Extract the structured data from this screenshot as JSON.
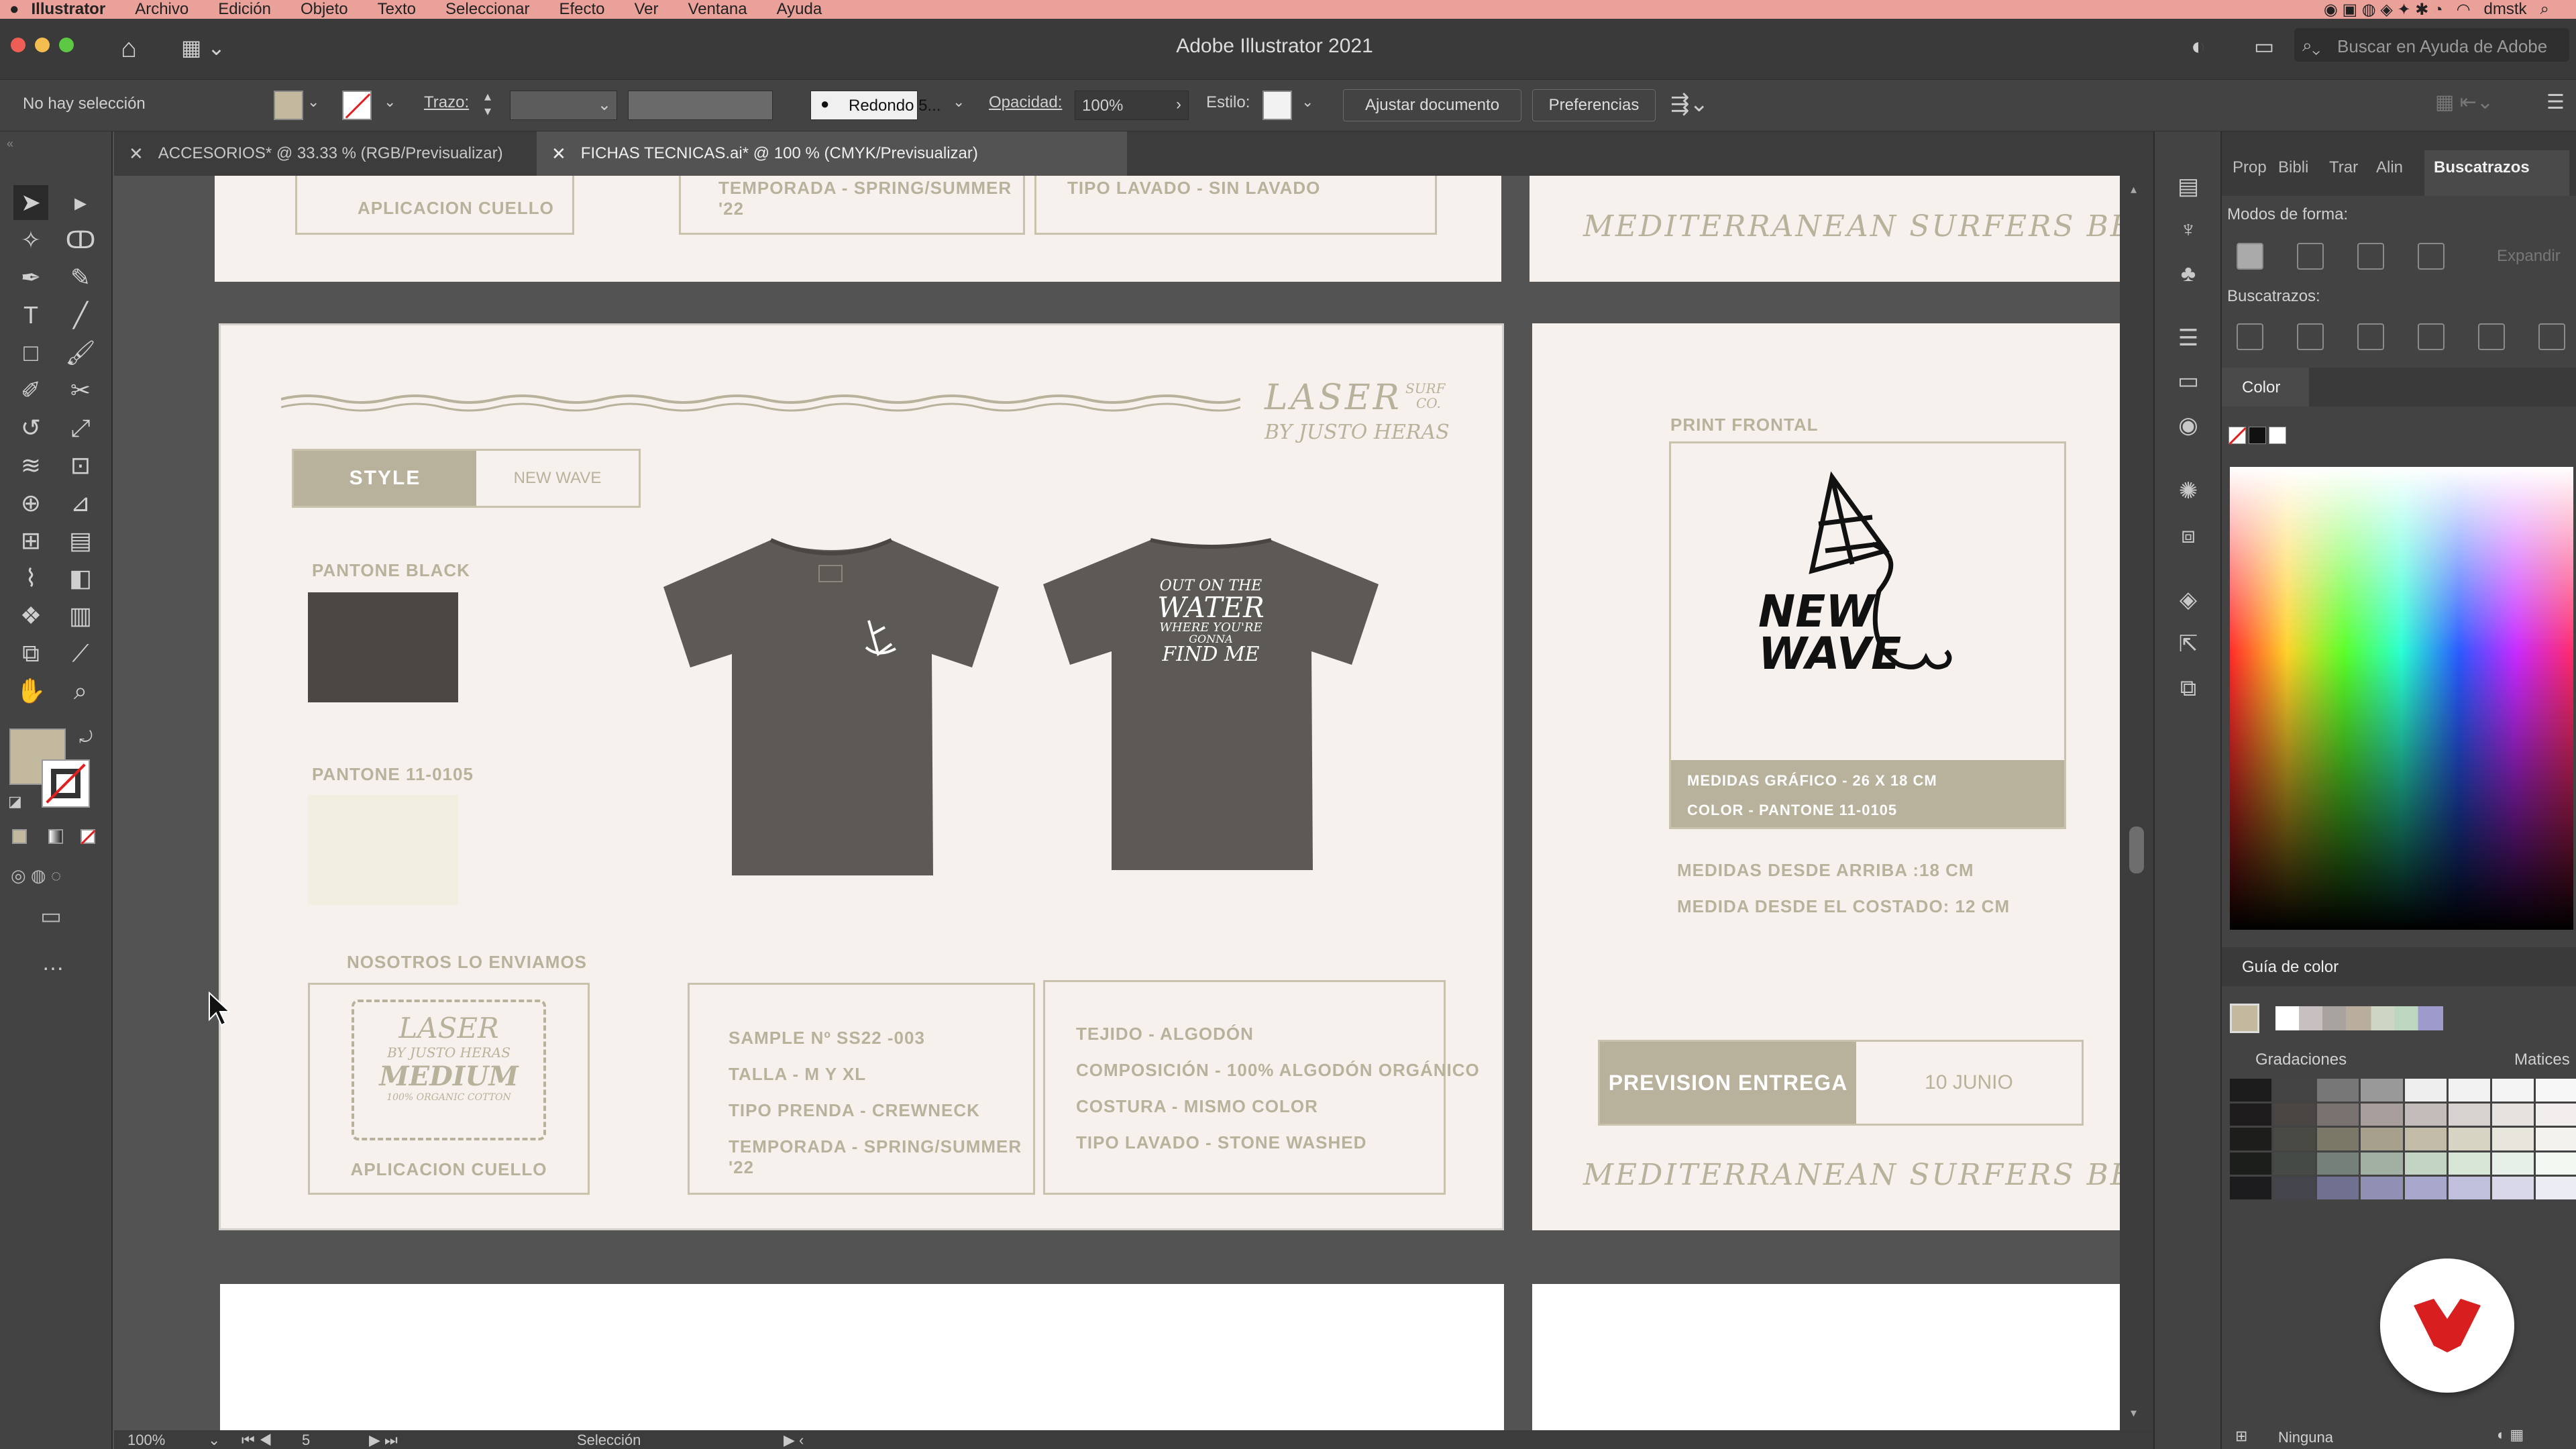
{
  "menubar": {
    "app_name": "Illustrator",
    "items": [
      "Archivo",
      "Edición",
      "Objeto",
      "Texto",
      "Seleccionar",
      "Efecto",
      "Ver",
      "Ventana",
      "Ayuda"
    ],
    "user": "dmstk"
  },
  "titlebar": {
    "title": "Adobe Illustrator 2021",
    "search_placeholder": "Buscar en Ayuda de Adobe"
  },
  "control_bar": {
    "selection": "No hay selección",
    "stroke_label": "Trazo:",
    "brush": "Redondo 5...",
    "opacity_label": "Opacidad:",
    "opacity_value": "100%",
    "style_label": "Estilo:",
    "fit_document": "Ajustar documento",
    "preferences": "Preferencias"
  },
  "tabs": [
    {
      "label": "ACCESORIOS* @ 33.33 % (RGB/Previsualizar)",
      "active": false
    },
    {
      "label": "FICHAS TECNICAS.ai* @ 100 % (CMYK/Previsualizar)",
      "active": true
    }
  ],
  "top_partial": {
    "collar": "APLICACION CUELLO",
    "season": "TEMPORADA - SPRING/SUMMER '22",
    "wash": "TIPO LAVADO -  SIN LAVADO",
    "slogan": "MEDITERRANEAN SURFERS  BE LIKE"
  },
  "board_left": {
    "brand_line1": "LASER",
    "brand_surf": "SURF",
    "brand_co": "CO.",
    "brand_line2": "BY JUSTO HERAS",
    "style_label": "STYLE",
    "style_value": "NEW WAVE",
    "pantone1_label": "PANTONE  BLACK",
    "pantone1_color": "#4b4744",
    "pantone2_label": "PANTONE 11-0105",
    "pantone2_color": "#f1efdf",
    "tshirt_color": "#5d5954",
    "back_print": [
      "OUT ON THE",
      "WATER",
      "WHERE YOU'RE",
      "GONNA",
      "FIND",
      "ME"
    ],
    "ship_label": "NOSOTROS LO ENVIAMOS",
    "label_brand": "LASER",
    "label_by": "BY JUSTO HERAS",
    "label_size": "MEDIUM",
    "label_cotton": "100% ORGANIC COTTON",
    "collar_label": "APLICACION CUELLO",
    "sample": [
      "SAMPLE Nº SS22 -003",
      "TALLA - M Y XL",
      "TIPO PRENDA - CREWNECK",
      "TEMPORADA - SPRING/SUMMER '22"
    ],
    "fabric": [
      "TEJIDO - ALGODÓN",
      "COMPOSICIÓN - 100% ALGODÓN ORGÁNICO",
      "COSTURA - MISMO COLOR",
      "TIPO LAVADO -  STONE WASHED"
    ]
  },
  "board_right": {
    "print_label": "PRINT FRONTAL",
    "logo_line1": "NEW",
    "logo_line2": "WAVE",
    "measure_box": [
      "MEDIDAS GRÁFICO - 26 X 18 CM",
      "COLOR - PANTONE 11-0105"
    ],
    "measures": [
      "MEDIDAS DESDE ARRIBA :18 CM",
      "MEDIDA DESDE EL COSTADO: 12 CM"
    ],
    "delivery_label": "PREVISION ENTREGA",
    "delivery_value": "10 JUNIO",
    "slogan": "MEDITERRANEAN SURFERS  BE LIKE"
  },
  "panels": {
    "tabs": [
      "Prop",
      "Bibli",
      "Trar",
      "Alin",
      "Buscatrazos"
    ],
    "shape_modes": "Modos de forma:",
    "expand": "Expandir",
    "pathfinders": "Buscatrazos:",
    "color_title": "Color",
    "guide_title": "Guía de color",
    "gradations": "Gradaciones",
    "shades": "Matices",
    "footer": "Ninguna"
  },
  "status": {
    "zoom": "100%",
    "page": "5",
    "tool": "Selección"
  },
  "colors": {
    "accent": "#b8b29c",
    "board": "#f6f1ed",
    "fill_swatch": "#c2b99f"
  }
}
